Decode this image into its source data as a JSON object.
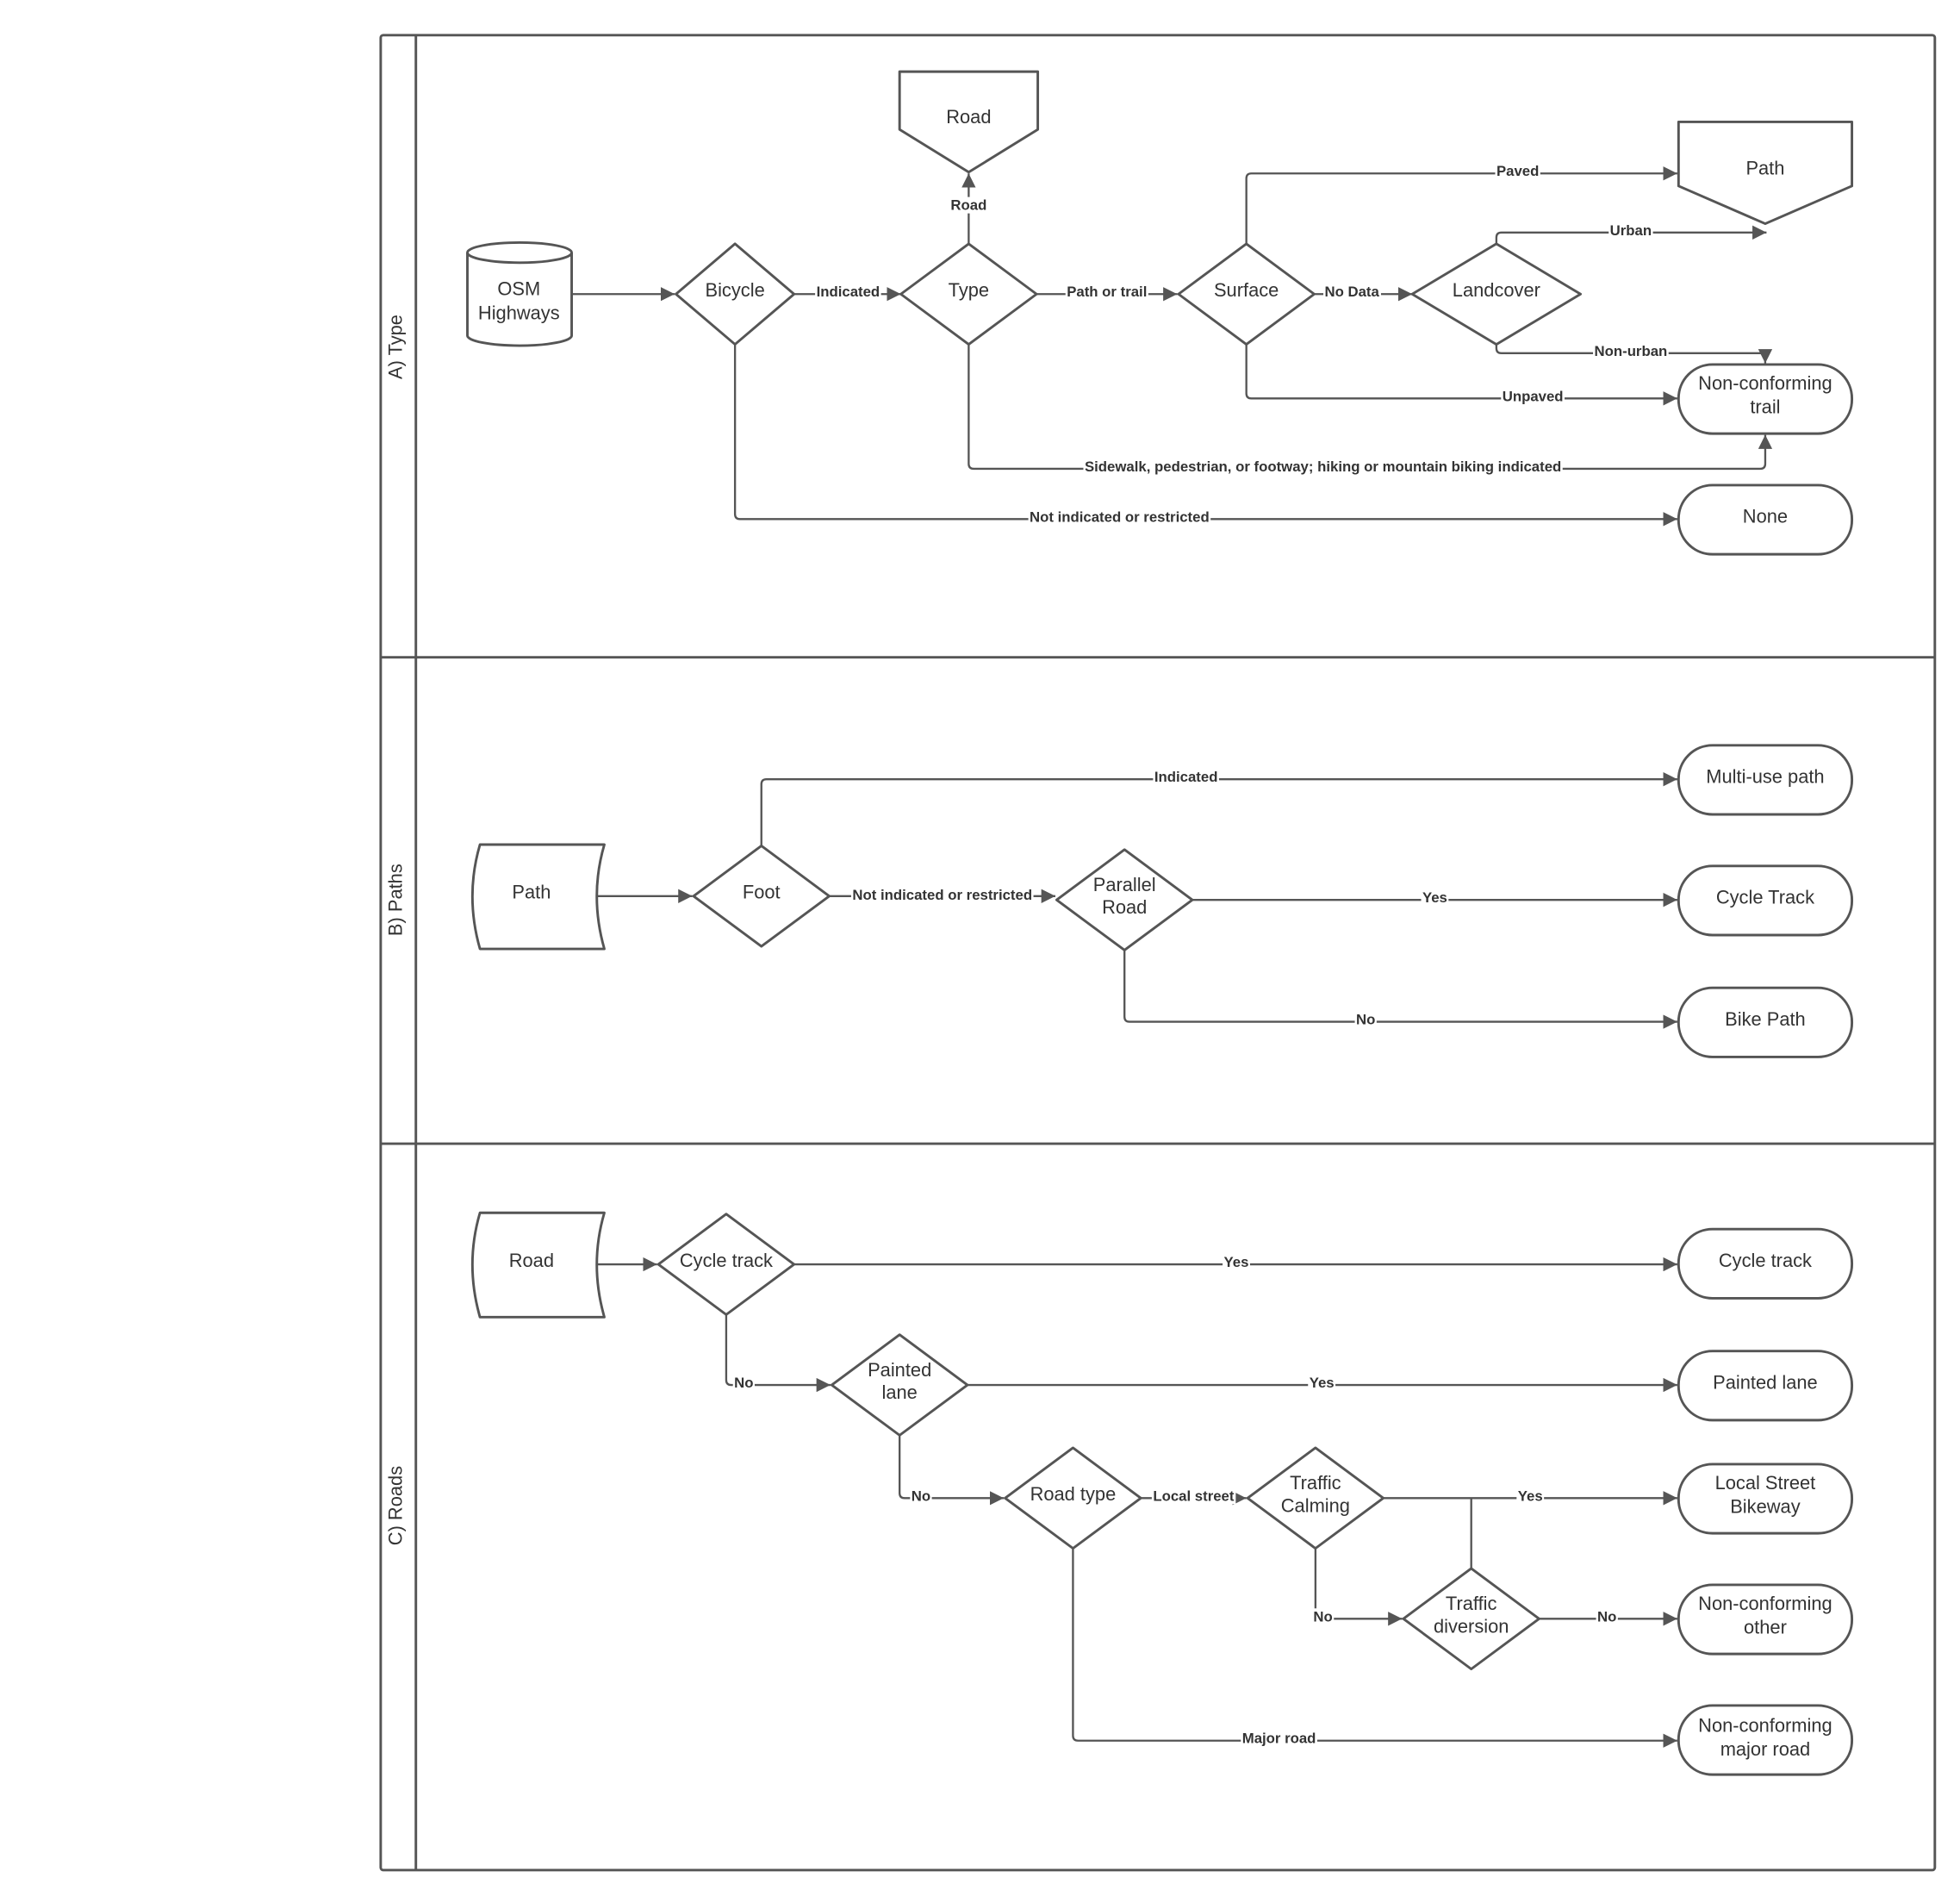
{
  "lanes": {
    "a": "A) Type",
    "b": "B) Paths",
    "c": "C) Roads"
  },
  "colors": {
    "stroke": "#555555",
    "background": "#ffffff",
    "text": "#333333"
  },
  "lane_a": {
    "nodes": {
      "osm": [
        "OSM",
        "Highways"
      ],
      "bicycle": "Bicycle",
      "type": "Type",
      "road": "Road",
      "surface": "Surface",
      "landcover": "Landcover",
      "path": "Path",
      "nc_trail": [
        "Non-conforming",
        "trail"
      ],
      "none": "None"
    },
    "edges": {
      "indicated": "Indicated",
      "road": "Road",
      "path_or_trail": "Path or trail",
      "no_data": "No Data",
      "paved": "Paved",
      "urban": "Urban",
      "non_urban": "Non-urban",
      "unpaved": "Unpaved",
      "sidewalk": "Sidewalk, pedestrian, or footway; hiking or mountain biking indicated",
      "not_indicated": "Not indicated or restricted"
    }
  },
  "lane_b": {
    "nodes": {
      "path": "Path",
      "foot": "Foot",
      "parallel": [
        "Parallel",
        "Road"
      ],
      "multi_use": "Multi-use path",
      "cycle_track": "Cycle Track",
      "bike_path": "Bike Path"
    },
    "edges": {
      "indicated": "Indicated",
      "not_indicated": "Not indicated or restricted",
      "yes": "Yes",
      "no": "No"
    }
  },
  "lane_c": {
    "nodes": {
      "road": "Road",
      "cycle_track_q": "Cycle track",
      "painted_q": [
        "Painted",
        "lane"
      ],
      "road_type": "Road type",
      "calming": [
        "Traffic",
        "Calming"
      ],
      "diversion": [
        "Traffic",
        "diversion"
      ],
      "cycle_track": "Cycle track",
      "painted_lane": "Painted lane",
      "local_bikeway": [
        "Local Street",
        "Bikeway"
      ],
      "nc_other": [
        "Non-conforming",
        "other"
      ],
      "nc_major": [
        "Non-conforming",
        "major road"
      ]
    },
    "edges": {
      "yes1": "Yes",
      "no1": "No",
      "yes2": "Yes",
      "no2": "No",
      "local_street": "Local street",
      "yes3": "Yes",
      "no3": "No",
      "no4": "No",
      "major_road": "Major road"
    }
  }
}
